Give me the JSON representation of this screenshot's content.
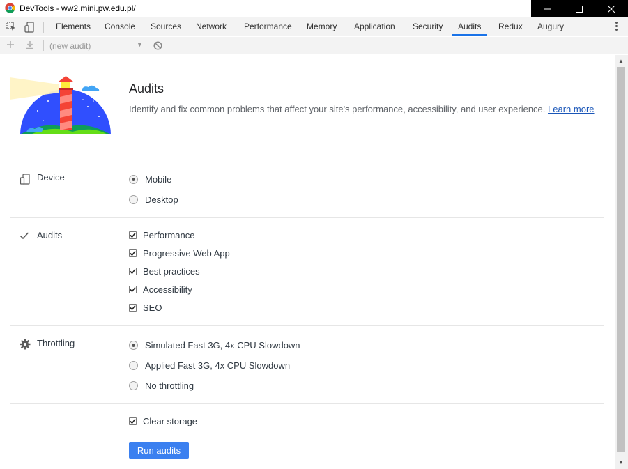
{
  "window": {
    "title": "DevTools - ww2.mini.pw.edu.pl/",
    "minimize_icon": "minimize-icon",
    "maximize_icon": "maximize-icon",
    "close_icon": "close-icon"
  },
  "tabs": [
    {
      "label": "Elements"
    },
    {
      "label": "Console"
    },
    {
      "label": "Sources"
    },
    {
      "label": "Network"
    },
    {
      "label": "Performance"
    },
    {
      "label": "Memory"
    },
    {
      "label": "Application"
    },
    {
      "label": "Security"
    },
    {
      "label": "Audits",
      "active": true
    },
    {
      "label": "Redux"
    },
    {
      "label": "Augury"
    }
  ],
  "toolbar": {
    "audit_select_value": "(new audit)"
  },
  "hero": {
    "title": "Audits",
    "description": "Identify and fix common problems that affect your site's performance, accessibility, and user experience.",
    "learn_more": "Learn more"
  },
  "sections": {
    "device": {
      "label": "Device",
      "options": [
        {
          "label": "Mobile",
          "selected": true
        },
        {
          "label": "Desktop",
          "selected": false
        }
      ]
    },
    "audits": {
      "label": "Audits",
      "options": [
        {
          "label": "Performance",
          "checked": true
        },
        {
          "label": "Progressive Web App",
          "checked": true
        },
        {
          "label": "Best practices",
          "checked": true
        },
        {
          "label": "Accessibility",
          "checked": true
        },
        {
          "label": "SEO",
          "checked": true
        }
      ]
    },
    "throttling": {
      "label": "Throttling",
      "options": [
        {
          "label": "Simulated Fast 3G, 4x CPU Slowdown",
          "selected": true
        },
        {
          "label": "Applied Fast 3G, 4x CPU Slowdown",
          "selected": false
        },
        {
          "label": "No throttling",
          "selected": false
        }
      ]
    },
    "storage": {
      "label": "Clear storage",
      "checked": true
    }
  },
  "run_button": "Run audits",
  "colors": {
    "accent": "#1a73e8",
    "button": "#3b80f0",
    "link": "#1a56b8"
  }
}
